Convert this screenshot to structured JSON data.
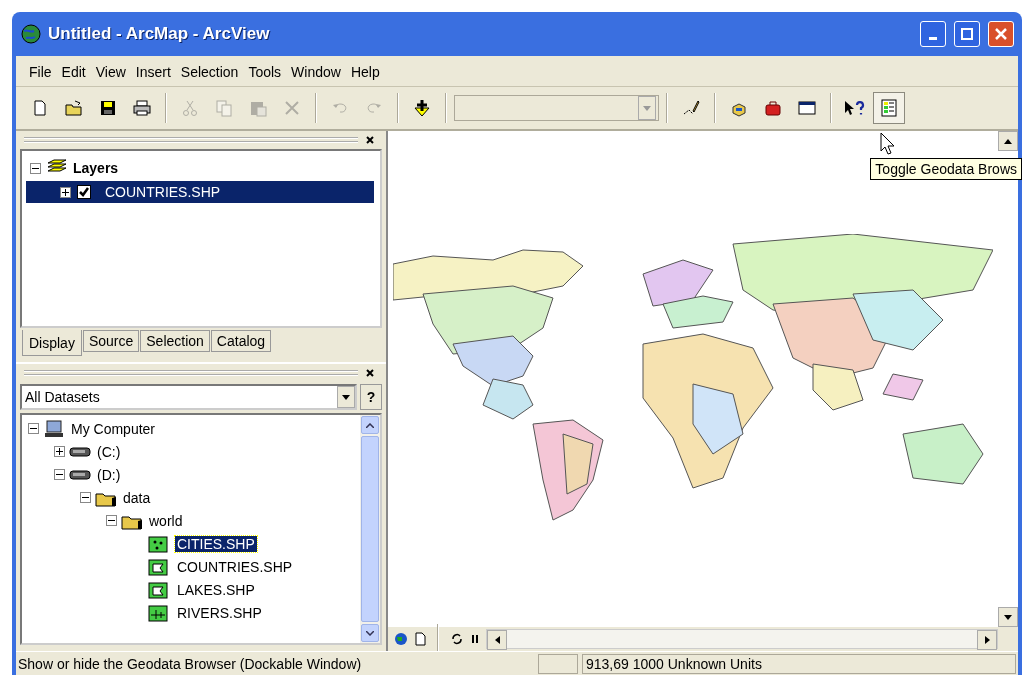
{
  "window": {
    "title": "Untitled - ArcMap - ArcView"
  },
  "menu": [
    "File",
    "Edit",
    "View",
    "Insert",
    "Selection",
    "Tools",
    "Window",
    "Help"
  ],
  "toolbar": [
    {
      "kind": "new",
      "disabled": false,
      "highlighted": false
    },
    {
      "kind": "open",
      "disabled": false,
      "highlighted": false
    },
    {
      "kind": "save",
      "disabled": false,
      "highlighted": false
    },
    {
      "kind": "print",
      "disabled": false,
      "highlighted": false
    },
    {
      "kind": "separator"
    },
    {
      "kind": "cut",
      "disabled": true,
      "highlighted": false
    },
    {
      "kind": "copy",
      "disabled": true,
      "highlighted": false
    },
    {
      "kind": "paste",
      "disabled": true,
      "highlighted": false
    },
    {
      "kind": "delete",
      "disabled": true,
      "highlighted": false
    },
    {
      "kind": "separator"
    },
    {
      "kind": "undo",
      "disabled": true,
      "highlighted": false
    },
    {
      "kind": "redo",
      "disabled": true,
      "highlighted": false
    },
    {
      "kind": "separator"
    },
    {
      "kind": "adddata",
      "disabled": false,
      "highlighted": false
    },
    {
      "kind": "separator"
    },
    {
      "kind": "scale",
      "disabled": true
    },
    {
      "kind": "separator"
    },
    {
      "kind": "editor",
      "disabled": false,
      "highlighted": false
    },
    {
      "kind": "separator"
    },
    {
      "kind": "catalog",
      "disabled": false,
      "highlighted": false
    },
    {
      "kind": "toolbox",
      "disabled": false,
      "highlighted": false
    },
    {
      "kind": "command",
      "disabled": false,
      "highlighted": false
    },
    {
      "kind": "separator"
    },
    {
      "kind": "whatsthis",
      "disabled": false,
      "highlighted": false
    },
    {
      "kind": "geodata",
      "disabled": false,
      "highlighted": true
    }
  ],
  "tooltip": "Toggle Geodata Brows",
  "toc": {
    "root": {
      "label": "Layers",
      "expanded": true
    },
    "layers": [
      {
        "label": "COUNTRIES.SHP",
        "checked": true,
        "expanded": false,
        "selected": true
      }
    ],
    "tabs": [
      {
        "label": "Display",
        "selected": true
      },
      {
        "label": "Source",
        "selected": false
      },
      {
        "label": "Selection",
        "selected": false
      },
      {
        "label": "Catalog",
        "selected": false
      }
    ]
  },
  "catalog": {
    "filter": "All Datasets",
    "help": "?",
    "tree": [
      {
        "label": "My Computer",
        "kind": "computer",
        "expanded": true,
        "selected": false,
        "children": [
          {
            "label": "(C:)",
            "kind": "drive",
            "expanded": false,
            "selected": false
          },
          {
            "label": "(D:)",
            "kind": "drive",
            "expanded": true,
            "selected": false,
            "children": [
              {
                "label": "data",
                "kind": "folder",
                "expanded": true,
                "selected": false,
                "children": [
                  {
                    "label": "world",
                    "kind": "folder",
                    "expanded": true,
                    "selected": false,
                    "children": [
                      {
                        "label": "CITIES.SHP",
                        "kind": "points",
                        "selected": true
                      },
                      {
                        "label": "COUNTRIES.SHP",
                        "kind": "polygons",
                        "selected": false
                      },
                      {
                        "label": "LAKES.SHP",
                        "kind": "polygons",
                        "selected": false
                      },
                      {
                        "label": "RIVERS.SHP",
                        "kind": "lines",
                        "selected": false
                      }
                    ]
                  }
                ]
              }
            ]
          }
        ]
      }
    ]
  },
  "status_bar": {
    "message": "Show or hide the Geodata Browser (Dockable Window)",
    "coordinates": "913,69  1000 Unknown Units"
  }
}
